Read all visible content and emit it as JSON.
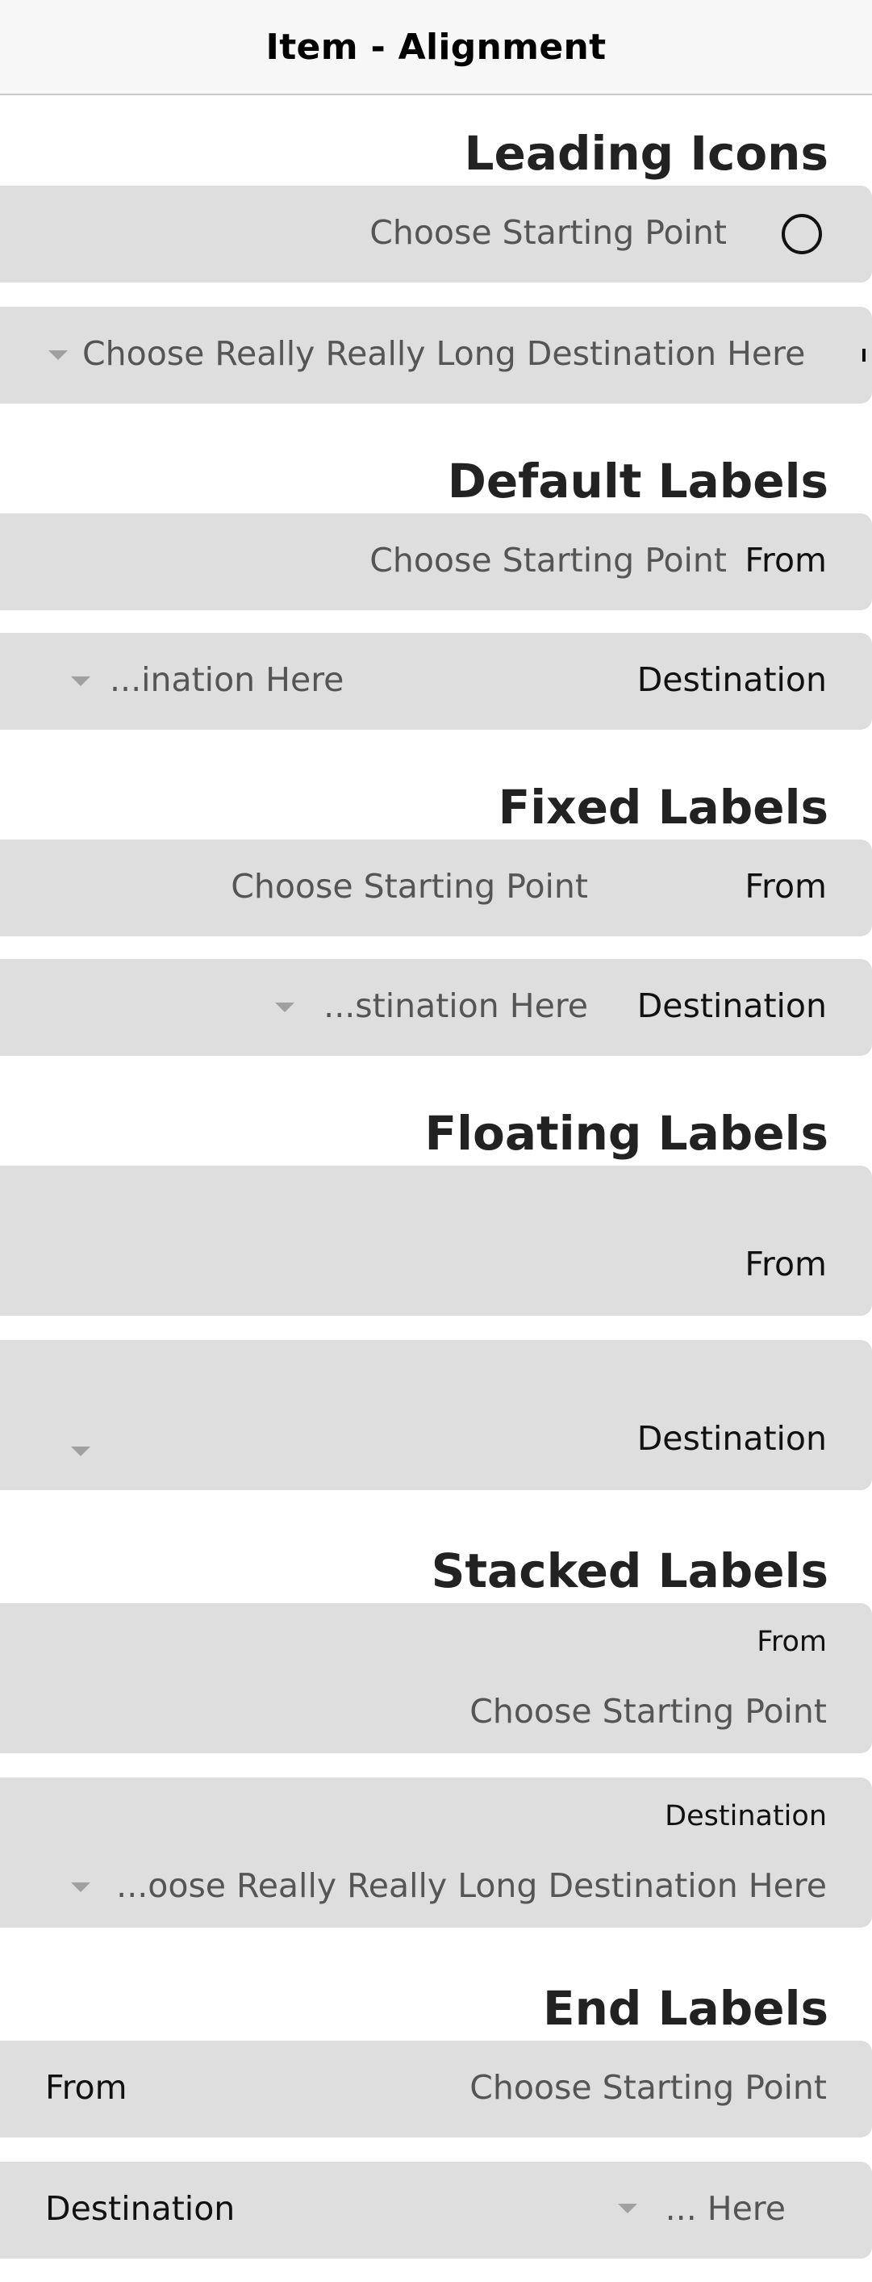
{
  "toolbar": {
    "title": "Item - Alignment"
  },
  "leading_icons": {
    "title": "Leading Icons",
    "from_placeholder": "Choose Starting Point",
    "from_icon": "radio-circle-icon",
    "destination_placeholder": "Choose Really Really Long Destination Here"
  },
  "default_labels": {
    "title": "Default Labels",
    "from_placeholder": "Choose Starting Point",
    "from_label": "From",
    "destination_value": "...ination Here",
    "destination_label": "Destination"
  },
  "fixed_labels": {
    "title": "Fixed Labels",
    "from_placeholder": "Choose Starting Point",
    "from_label": "From",
    "destination_value": "...stination Here",
    "destination_label": "Destination"
  },
  "floating_labels": {
    "title": "Floating Labels",
    "from_label": "From",
    "destination_label": "Destination"
  },
  "stacked_labels": {
    "title": "Stacked Labels",
    "from_label": "From",
    "from_placeholder": "Choose Starting Point",
    "destination_label": "Destination",
    "destination_value": "...oose Really Really Long Destination Here"
  },
  "end_labels": {
    "title": "End Labels",
    "from_label": "From",
    "from_placeholder": "Choose Starting Point",
    "destination_label": "Destination",
    "destination_value": "... Here"
  }
}
